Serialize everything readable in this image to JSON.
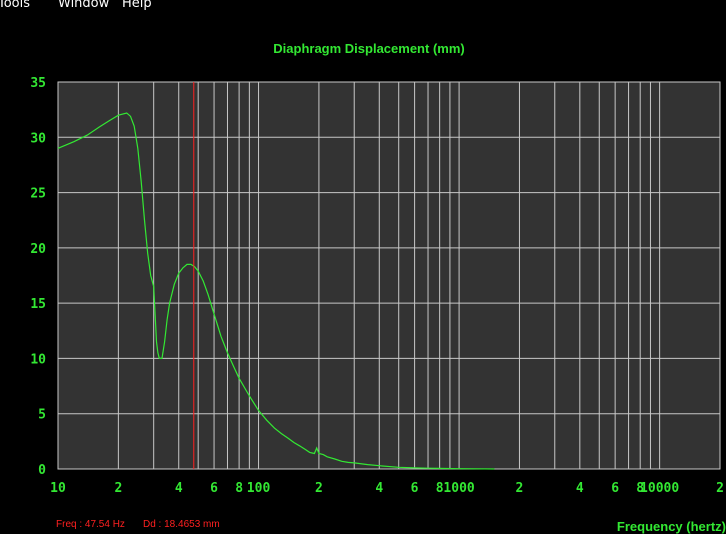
{
  "menu": {
    "items": [
      "Tools",
      "Window",
      "Help"
    ]
  },
  "status": {
    "freq": "Freq : 47.54 Hz",
    "dd": "Dd : 18.4653 mm"
  },
  "colors": {
    "background": "#000000",
    "plot_area": "#333333",
    "grid": "#c8c8c8",
    "text": "#33e833",
    "curve": "#33e833",
    "cursor": "#ff2020"
  },
  "chart_data": {
    "type": "line",
    "title": "Diaphragm Displacement (mm)",
    "xlabel": "Frequency (hertz)",
    "ylabel": "",
    "x_scale": "log",
    "xlim": [
      10,
      20000
    ],
    "ylim": [
      0,
      35
    ],
    "grid": true,
    "x_tick_values": [
      10,
      20,
      40,
      60,
      80,
      100,
      200,
      400,
      600,
      800,
      1000,
      2000,
      4000,
      6000,
      8000,
      10000,
      20000
    ],
    "x_tick_labels": [
      "10",
      "2",
      "4",
      "6",
      "8",
      "100",
      "2",
      "4",
      "6",
      "8",
      "1000",
      "2",
      "4",
      "6",
      "8",
      "10000",
      "2"
    ],
    "y_ticks": [
      0,
      5,
      10,
      15,
      20,
      25,
      30,
      35
    ],
    "cursor": {
      "x": 47.54,
      "y": 18.4653
    },
    "series": [
      {
        "x": [
          10,
          12,
          14,
          16,
          18,
          20,
          22,
          23,
          24,
          25,
          26,
          27,
          28,
          29,
          30,
          30.5,
          31,
          31.5,
          32,
          33,
          34,
          35,
          36,
          38,
          40,
          42,
          44,
          46,
          48,
          50,
          53,
          56,
          60,
          65,
          70,
          75,
          80,
          90,
          100,
          110,
          120,
          130,
          140,
          150,
          160,
          170,
          180,
          190,
          195,
          200,
          210,
          220,
          240,
          260,
          280,
          300,
          350,
          400,
          500,
          600,
          700,
          800,
          1000,
          1200,
          1500
        ],
        "values": [
          29.0,
          29.6,
          30.2,
          30.9,
          31.5,
          32.0,
          32.2,
          31.9,
          31.0,
          29.0,
          26.0,
          22.5,
          19.5,
          17.5,
          16.5,
          14.0,
          11.5,
          10.5,
          10.0,
          10.0,
          11.5,
          13.5,
          15.0,
          16.7,
          17.7,
          18.2,
          18.5,
          18.5,
          18.3,
          17.9,
          17.0,
          15.8,
          14.0,
          12.0,
          10.5,
          9.3,
          8.2,
          6.6,
          5.3,
          4.4,
          3.7,
          3.2,
          2.8,
          2.4,
          2.1,
          1.8,
          1.5,
          1.4,
          1.9,
          1.4,
          1.3,
          1.1,
          0.9,
          0.7,
          0.6,
          0.55,
          0.4,
          0.3,
          0.15,
          0.1,
          0.07,
          0.05,
          0.03,
          0.02,
          0.0
        ]
      }
    ]
  }
}
